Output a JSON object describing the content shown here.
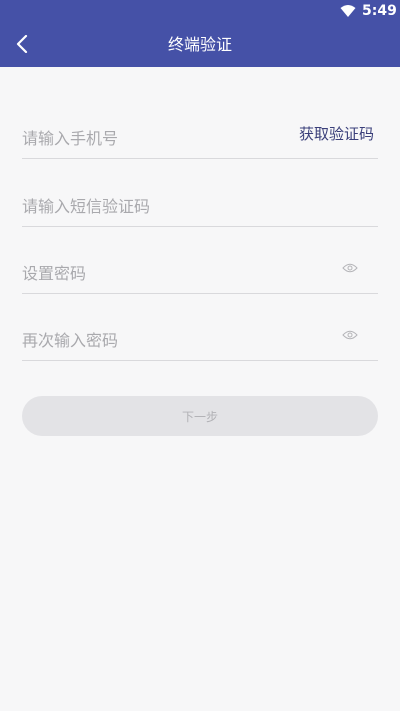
{
  "status_bar": {
    "time": "5:49",
    "wifi_icon": "wifi-icon"
  },
  "header": {
    "title": "终端验证",
    "back_icon": "chevron-left-icon",
    "color": "#4551a7"
  },
  "form": {
    "phone": {
      "placeholder": "请输入手机号",
      "value": ""
    },
    "get_code_label": "获取验证码",
    "sms_code": {
      "placeholder": "请输入短信验证码",
      "value": ""
    },
    "password": {
      "placeholder": "设置密码",
      "value": "",
      "icon": "eye-icon"
    },
    "confirm_password": {
      "placeholder": "再次输入密码",
      "value": "",
      "icon": "eye-icon"
    },
    "next_label": "下一步"
  }
}
